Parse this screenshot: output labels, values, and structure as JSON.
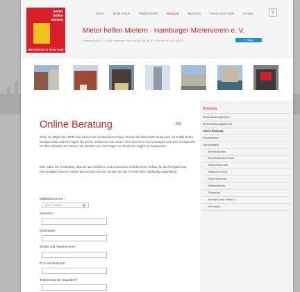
{
  "logo": {
    "line1": "mieter",
    "line2": "helfen",
    "line3": "mietern",
    "band": "MIETERSCHUTZ BERATUNG"
  },
  "topnav": {
    "items": [
      "Home",
      "MHM-Verein",
      "Mitgliedschaft",
      "Beratung",
      "Mietrecht",
      "Presse und Politik",
      "Kontakt"
    ],
    "active_index": 3
  },
  "search": {
    "glyph": "⚲"
  },
  "header": {
    "title": "Mieter helfen Mietern · Hamburger Mieterverein e. V.",
    "address": "Bartelsstraße 30 · 20357 Hamburg · Fon +49 40 431 39 40 · Fax +49 40 431 394 44",
    "follow_label": "Folgen",
    "follow_glyph": "✔"
  },
  "article": {
    "title": "Online Beratung",
    "print_icon": "printer-icon",
    "para1": "Wenn Sie Mitglied bei MHM sind, können Sie mietrechtliche Fragen für eine schnelle Mietberatung auch per E-Mail stellen. Geeignet sind einfache Fragen, die unsere Juristinnen und Juristen ohne Einsicht in Ihre Unterlagen und ohne Rückspräche mit Ihnen beantworten können. Wir bemühen uns Ihre Fragen so schnell wie möglich zu beantworten.",
    "para2": "Bitte haben Sie Verständnis, dass wir aus rechtlichen und technischen Gründen keine Haftung für die Richtigkeit und Rechtzeitigkeit unserer Antwort übernehmen können. Senden Sie das Formular bitte vollständig ausgefüllt ab."
  },
  "form": {
    "member_label": "Mitgliedsnummer",
    "member_placeholder": "Max. 5 Ziffern",
    "eye_glyph": "👁",
    "req_mark": "*",
    "fields": [
      "Vorname",
      "Nachname",
      "Straße und Hausnummer",
      "PLZ und Wohnort",
      "Telefonnummer (tagsüber)"
    ]
  },
  "sidebar": {
    "heading": "Beratung",
    "items": [
      {
        "label": "MHM-Beratungsstellen",
        "level": 0
      },
      {
        "label": "MHM-Beratungskalender",
        "level": 0
      },
      {
        "label": "Online Beratung",
        "level": 0,
        "active": true
      },
      {
        "label": "Rechtstelefon",
        "level": 0
      },
      {
        "label": "Spezialfragen",
        "level": 0
      },
      {
        "label": "Betriebskosten",
        "level": 1
      },
      {
        "label": "Betriebskosten-Check",
        "level": 1
      },
      {
        "label": "Mietpreisbremse",
        "level": 1
      },
      {
        "label": "Mietpreis-Check",
        "level": 1
      },
      {
        "label": "Modernisierung",
        "level": 1
      },
      {
        "label": "Ratenmietung",
        "level": 1
      },
      {
        "label": "Schimmel",
        "level": 1
      },
      {
        "label": "Wohnen unter Hartz IV",
        "level": 1
      },
      {
        "label": "Wohngeld",
        "level": 1
      }
    ]
  },
  "colors": {
    "accent": "#d71f2b",
    "yellow": "#f3c21b",
    "follow": "#1d8fe0"
  }
}
